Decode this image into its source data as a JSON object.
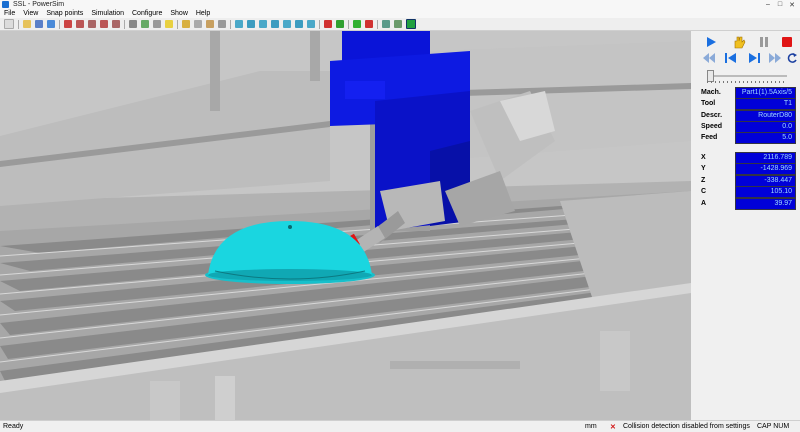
{
  "window": {
    "title": "SSL - PowerSim",
    "minimize": "‒",
    "maximize": "□",
    "close": "✕"
  },
  "menu": [
    "File",
    "View",
    "Snap points",
    "Simulation",
    "Configure",
    "Show",
    "Help"
  ],
  "toolbar_icons": [
    "new-icon",
    "open-icon",
    "save-icon",
    "import-icon",
    "zoom-icon",
    "zoom-in-icon",
    "zoom-out-icon",
    "zoom-window-icon",
    "zoom-fit-icon",
    "frame-icon",
    "rotate-icon",
    "pan-icon",
    "light-icon",
    "measure-icon",
    "edit-icon",
    "settings-icon",
    "grid-icon",
    "view-iso-icon",
    "view-front-icon",
    "view-top-icon",
    "view-side-icon",
    "view-back-icon",
    "view-bottom-icon",
    "view-left-icon",
    "arrow-left-icon",
    "arrow-right-icon",
    "check-icon",
    "flag-icon",
    "tool-icon",
    "sim-icon",
    "shield-icon"
  ],
  "panel": {
    "controls_top": [
      "play-icon",
      "hand-icon",
      "pause-icon",
      "stop-icon"
    ],
    "controls_bottom": [
      "rewind-icon",
      "step-back-icon",
      "step-forward-icon",
      "fast-forward-icon",
      "loop-icon"
    ],
    "fields": [
      {
        "label": "Mach.",
        "value": "Part1(1).5Axis/5"
      },
      {
        "label": "Tool",
        "value": "T1"
      },
      {
        "label": "Descr.",
        "value": "RouterD80"
      },
      {
        "label": "Speed",
        "value": "0.0"
      },
      {
        "label": "Feed",
        "value": "5.0"
      }
    ],
    "coords": [
      {
        "label": "X",
        "value": "2116.789"
      },
      {
        "label": "Y",
        "value": "-1428.969"
      },
      {
        "label": "Z",
        "value": "-338.447"
      },
      {
        "label": "C",
        "value": "105.10"
      },
      {
        "label": "A",
        "value": "39.97"
      }
    ]
  },
  "status": {
    "ready": "Ready",
    "units": "mm",
    "collision_icon": "✕",
    "message": "Collision detection disabled from settings",
    "caps": "CAP   NUM"
  },
  "colors": {
    "spindle_blue": "#0a14d8",
    "part_cyan": "#19d6e0",
    "tool_red": "#e01515",
    "value_bg": "#0000d8"
  }
}
